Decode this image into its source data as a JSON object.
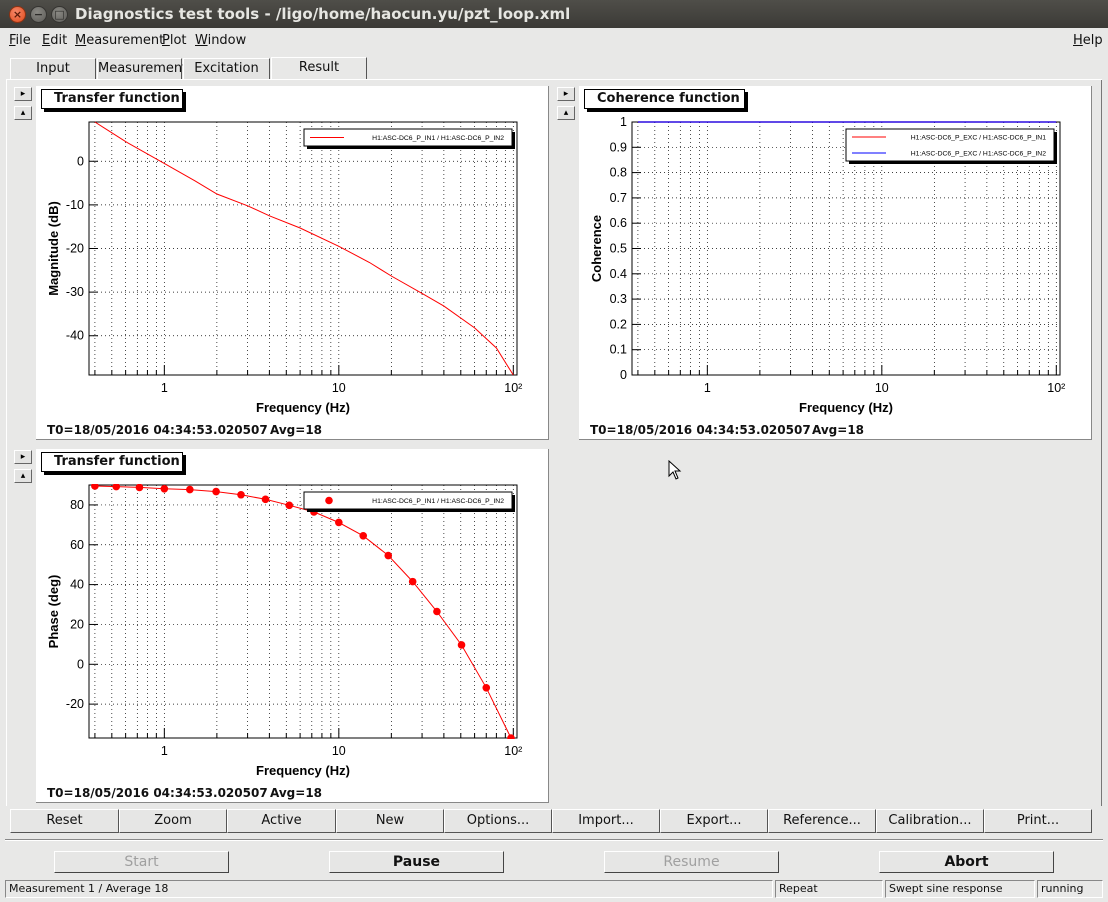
{
  "window": {
    "title": "Diagnostics test tools - /ligo/home/haocun.yu/pzt_loop.xml",
    "close_glyph": "×",
    "min_glyph": "−",
    "max_glyph": "□"
  },
  "menu": {
    "file": "File",
    "edit": "Edit",
    "measurement": "Measurement",
    "plot": "Plot",
    "window": "Window",
    "help": "Help"
  },
  "tabs": [
    {
      "label": "Input"
    },
    {
      "label": "Measurement"
    },
    {
      "label": "Excitation"
    },
    {
      "label": "Result"
    }
  ],
  "active_tab": "Result",
  "pads": {
    "magnitude": {
      "title": "Transfer function",
      "xlabel": "Frequency (Hz)",
      "ylabel": "Magnitude (dB)",
      "legend": "H1:ASC-DC6_P_IN1 / H1:ASC-DC6_P_IN2",
      "t0": "T0=18/05/2016 04:34:53.020507",
      "avg": "Avg=18"
    },
    "coherence": {
      "title": "Coherence function",
      "xlabel": "Frequency (Hz)",
      "ylabel": "Coherence",
      "legend1": "H1:ASC-DC6_P_EXC / H1:ASC-DC6_P_IN1",
      "legend2": "H1:ASC-DC6_P_EXC / H1:ASC-DC6_P_IN2",
      "t0": "T0=18/05/2016 04:34:53.020507",
      "avg": "Avg=18"
    },
    "phase": {
      "title": "Transfer function",
      "xlabel": "Frequency (Hz)",
      "ylabel": "Phase (deg)",
      "legend": "H1:ASC-DC6_P_IN1 / H1:ASC-DC6_P_IN2",
      "t0": "T0=18/05/2016 04:34:53.020507",
      "avg": "Avg=18"
    }
  },
  "chart_data": [
    {
      "type": "line",
      "title": "Transfer function",
      "xlabel": "Frequency (Hz)",
      "ylabel": "Magnitude (dB)",
      "xscale": "log",
      "xlim": [
        0.37,
        105
      ],
      "ylim": [
        -49,
        9
      ],
      "xticks": [
        "1",
        "10",
        "10²"
      ],
      "yticks": [
        0,
        -10,
        -20,
        -30,
        -40
      ],
      "grid": true,
      "legend_position": "top-right",
      "color": "#ff0000",
      "series": [
        {
          "name": "H1:ASC-DC6_P_IN1 / H1:ASC-DC6_P_IN2",
          "x": [
            0.4,
            0.6,
            1,
            1.5,
            2,
            3,
            4,
            6,
            10,
            15,
            20,
            30,
            40,
            60,
            80,
            100
          ],
          "y": [
            9,
            4.5,
            -0.5,
            -4.5,
            -7.5,
            -10.2,
            -12.5,
            -15.3,
            -19.5,
            -23.2,
            -26.3,
            -30.3,
            -33.2,
            -38.2,
            -42.8,
            -49
          ]
        }
      ]
    },
    {
      "type": "line",
      "title": "Coherence function",
      "xlabel": "Frequency (Hz)",
      "ylabel": "Coherence",
      "xscale": "log",
      "xlim": [
        0.37,
        105
      ],
      "ylim": [
        0,
        1
      ],
      "xticks": [
        "1",
        "10",
        "10²"
      ],
      "yticks": [
        0,
        0.1,
        0.2,
        0.3,
        0.4,
        0.5,
        0.6,
        0.7,
        0.8,
        0.9,
        1
      ],
      "grid": true,
      "legend_position": "top-right",
      "series": [
        {
          "name": "H1:ASC-DC6_P_EXC / H1:ASC-DC6_P_IN1",
          "color": "#ff0000",
          "x": [
            0.4,
            100
          ],
          "y": [
            1,
            1
          ]
        },
        {
          "name": "H1:ASC-DC6_P_EXC / H1:ASC-DC6_P_IN2",
          "color": "#0000ff",
          "x": [
            0.4,
            100
          ],
          "y": [
            1,
            1
          ]
        }
      ]
    },
    {
      "type": "scatter",
      "title": "Transfer function",
      "xlabel": "Frequency (Hz)",
      "ylabel": "Phase (deg)",
      "xscale": "log",
      "xlim": [
        0.37,
        105
      ],
      "ylim": [
        -37,
        90
      ],
      "xticks": [
        "1",
        "10",
        "10²"
      ],
      "yticks": [
        80,
        60,
        40,
        20,
        0,
        -20
      ],
      "grid": true,
      "legend_position": "top-right",
      "color": "#ff0000",
      "series": [
        {
          "name": "H1:ASC-DC6_P_IN1 / H1:ASC-DC6_P_IN2",
          "x": [
            0.4,
            0.53,
            0.72,
            1.0,
            1.4,
            1.98,
            2.75,
            3.8,
            5.2,
            7.2,
            10,
            13.8,
            19.2,
            26.5,
            36.5,
            50.5,
            70,
            97
          ],
          "y": [
            89.5,
            89.2,
            88.8,
            88.1,
            87.7,
            86.7,
            85.1,
            82.8,
            79.8,
            76.5,
            71.2,
            64.5,
            54.6,
            41.5,
            26.5,
            9.7,
            -11.8,
            -37
          ]
        }
      ]
    }
  ],
  "buttons": {
    "reset": "Reset",
    "zoom": "Zoom",
    "active": "Active",
    "new": "New",
    "options": "Options...",
    "import": "Import...",
    "export": "Export...",
    "reference": "Reference...",
    "calibration": "Calibration...",
    "print": "Print..."
  },
  "controls": {
    "start": "Start",
    "pause": "Pause",
    "resume": "Resume",
    "abort": "Abort"
  },
  "status": {
    "message": "Measurement 1 / Average 18",
    "repeat": "Repeat",
    "type": "Swept sine response",
    "state": "running"
  },
  "spin_glyphs": {
    "right": "▸",
    "up": "▴"
  },
  "colors": {
    "trace": "#ff0000",
    "trace2": "#0000ff",
    "titlebar": "#3f3e3a"
  }
}
